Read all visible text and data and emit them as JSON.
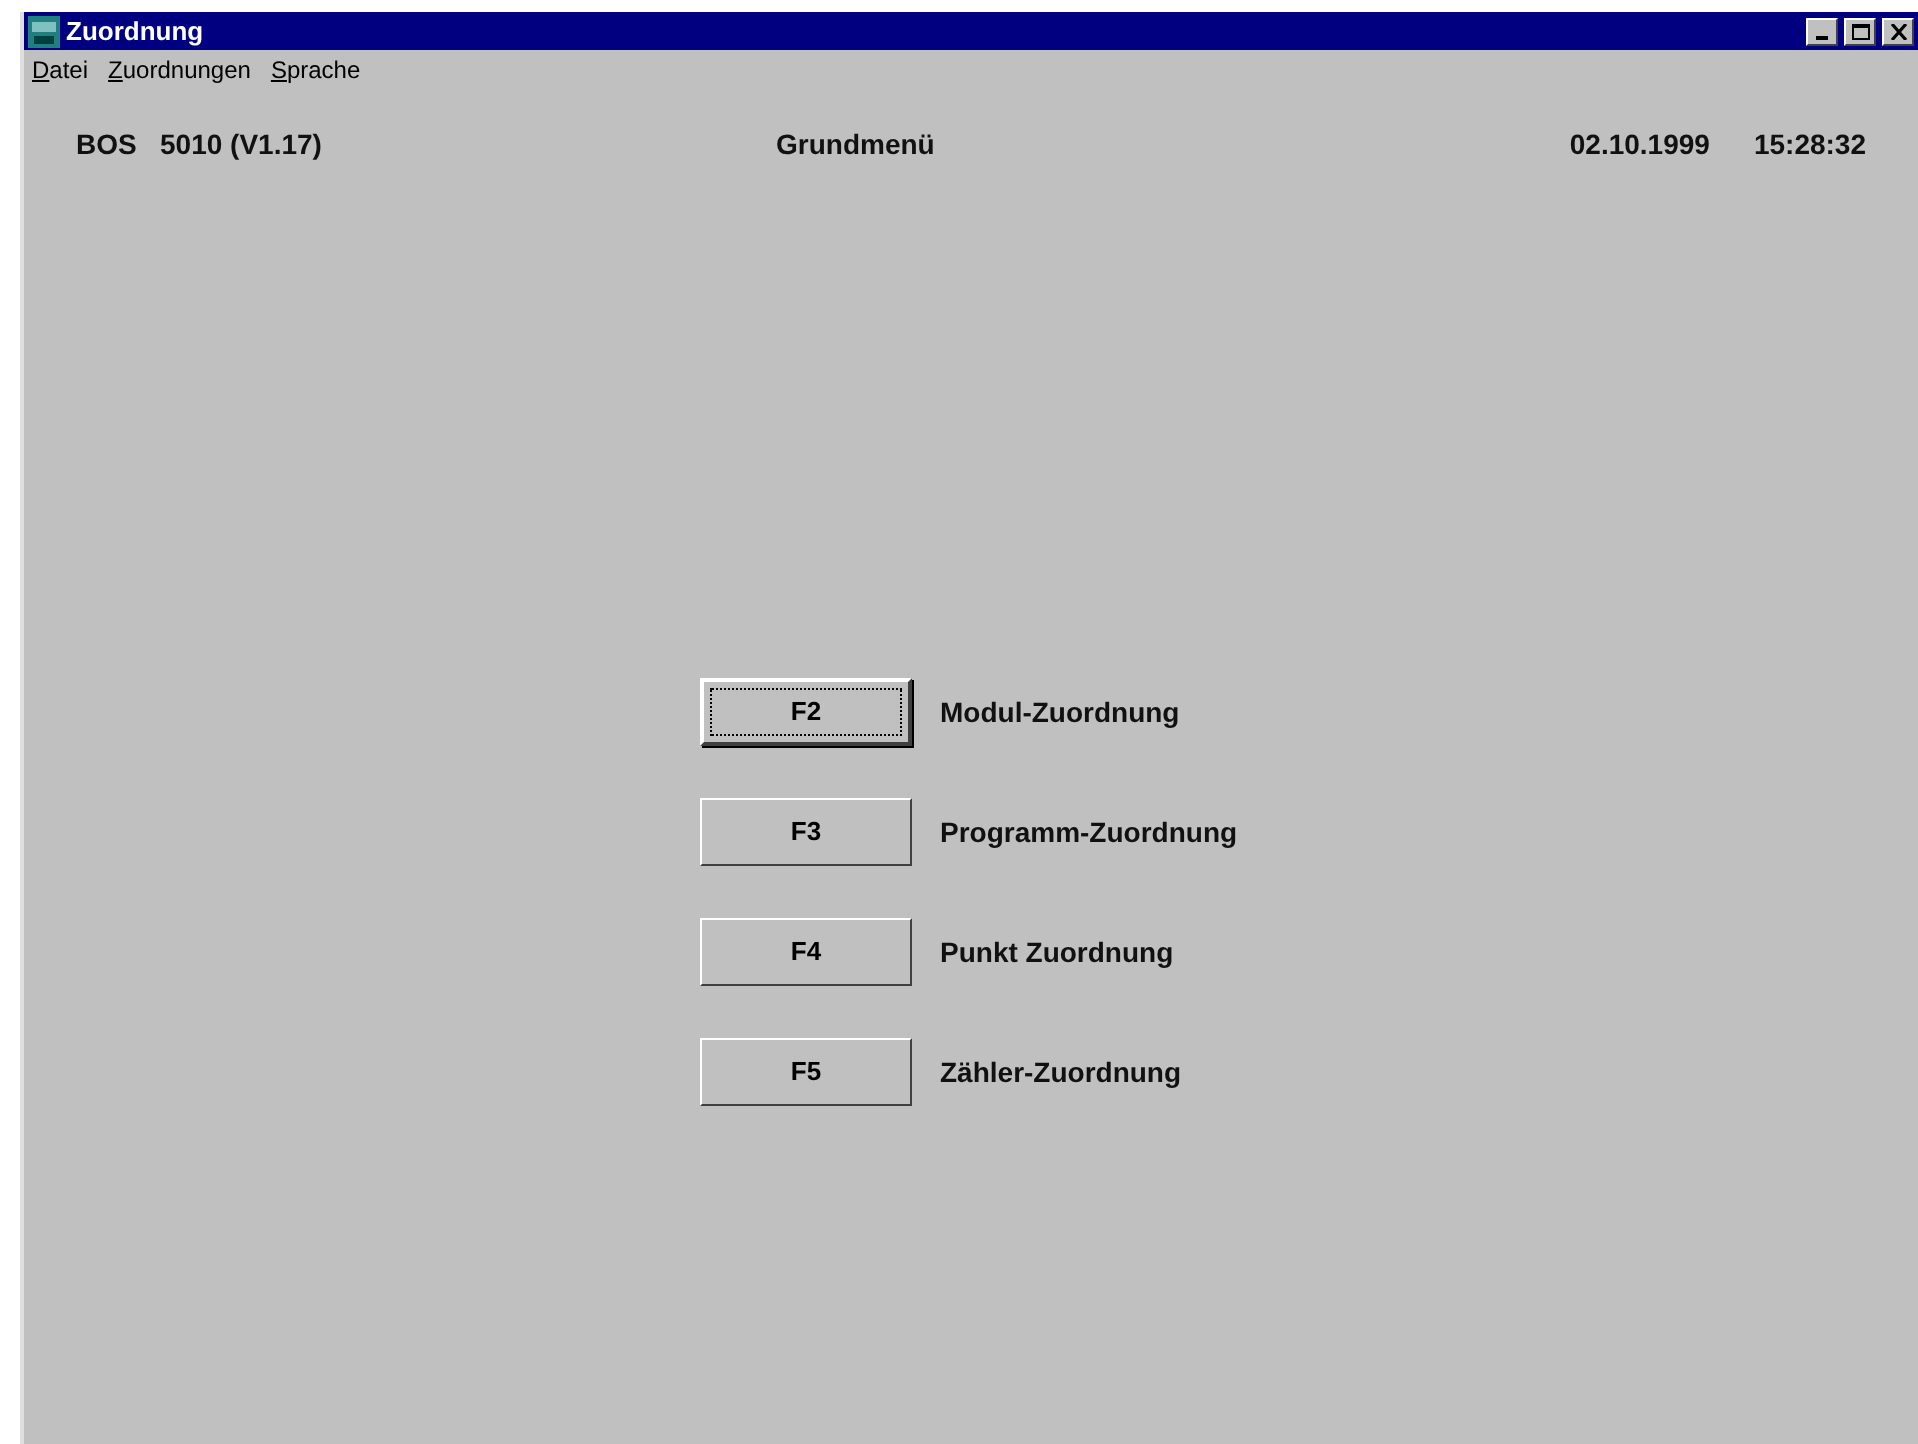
{
  "window": {
    "title": "Zuordnung"
  },
  "menu": [
    {
      "label": "Datei"
    },
    {
      "label": "Zuordnungen"
    },
    {
      "label": "Sprache"
    }
  ],
  "header": {
    "device": "BOS   5010 (V1.17)",
    "screen": "Grundmenü",
    "date": "02.10.1999",
    "time": "15:28:32"
  },
  "actions": [
    {
      "key": "F2",
      "label": "Modul-Zuordnung",
      "focused": true
    },
    {
      "key": "F3",
      "label": "Programm-Zuordnung",
      "focused": false
    },
    {
      "key": "F4",
      "label": "Punkt Zuordnung",
      "focused": false
    },
    {
      "key": "F5",
      "label": "Zähler-Zuordnung",
      "focused": false
    }
  ]
}
